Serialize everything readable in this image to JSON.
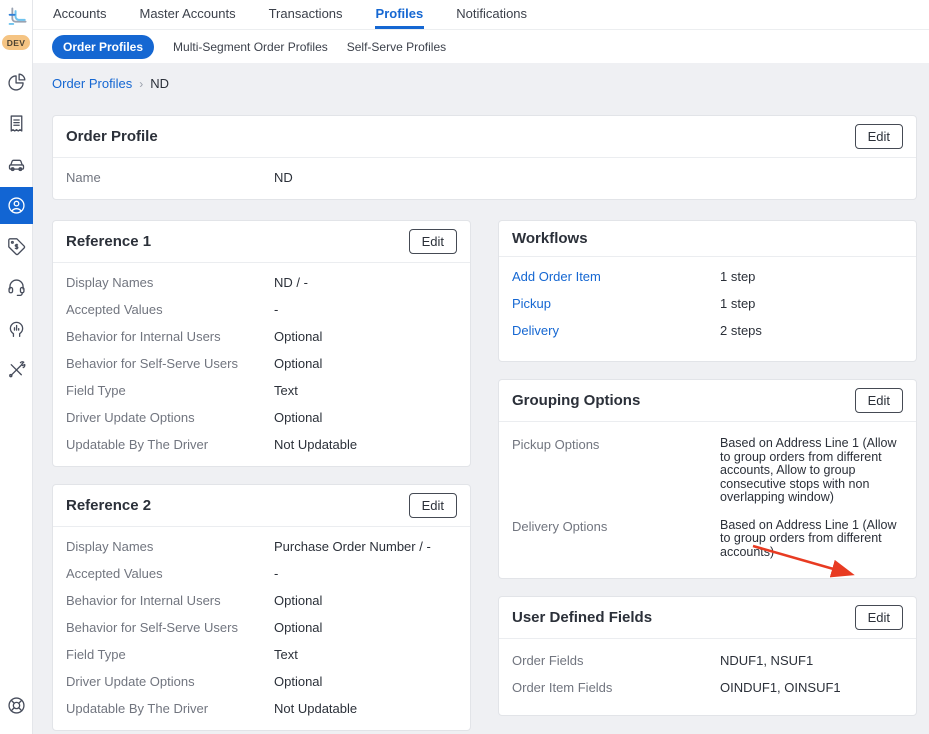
{
  "accent_color": "#1567d2",
  "sidebar": {
    "logo_icon": "route-logo",
    "badge": "DEV",
    "items": [
      {
        "icon": "pie-chart",
        "active": false
      },
      {
        "icon": "receipt",
        "active": false
      },
      {
        "icon": "car",
        "active": false
      },
      {
        "icon": "person-profile",
        "active": true
      },
      {
        "icon": "price-tag",
        "active": false
      },
      {
        "icon": "headset-support",
        "active": false
      },
      {
        "icon": "insights-head",
        "active": false
      },
      {
        "icon": "tools",
        "active": false
      }
    ],
    "bottom_icon": "help-lifebuoy"
  },
  "topnav": {
    "tabs": [
      {
        "label": "Accounts",
        "active": false
      },
      {
        "label": "Master Accounts",
        "active": false
      },
      {
        "label": "Transactions",
        "active": false
      },
      {
        "label": "Profiles",
        "active": true
      },
      {
        "label": "Notifications",
        "active": false
      }
    ]
  },
  "subnav": {
    "tabs": [
      {
        "label": "Order Profiles",
        "active": true
      },
      {
        "label": "Multi-Segment Order Profiles",
        "active": false
      },
      {
        "label": "Self-Serve Profiles",
        "active": false
      }
    ]
  },
  "breadcrumb": {
    "link": "Order Profiles",
    "separator": "›",
    "current": "ND"
  },
  "cards": {
    "order_profile": {
      "title": "Order Profile",
      "edit_label": "Edit",
      "rows": [
        {
          "label": "Name",
          "value": "ND"
        }
      ]
    },
    "reference1": {
      "title": "Reference 1",
      "edit_label": "Edit",
      "rows": [
        {
          "label": "Display Names",
          "value": "ND / -"
        },
        {
          "label": "Accepted Values",
          "value": "-"
        },
        {
          "label": "Behavior for Internal Users",
          "value": "Optional"
        },
        {
          "label": "Behavior for Self-Serve Users",
          "value": "Optional"
        },
        {
          "label": "Field Type",
          "value": "Text"
        },
        {
          "label": "Driver Update Options",
          "value": "Optional"
        },
        {
          "label": "Updatable By The Driver",
          "value": "Not Updatable"
        }
      ]
    },
    "reference2": {
      "title": "Reference 2",
      "edit_label": "Edit",
      "rows": [
        {
          "label": "Display Names",
          "value": "Purchase Order Number / -"
        },
        {
          "label": "Accepted Values",
          "value": "-"
        },
        {
          "label": "Behavior for Internal Users",
          "value": "Optional"
        },
        {
          "label": "Behavior for Self-Serve Users",
          "value": "Optional"
        },
        {
          "label": "Field Type",
          "value": "Text"
        },
        {
          "label": "Driver Update Options",
          "value": "Optional"
        },
        {
          "label": "Updatable By The Driver",
          "value": "Not Updatable"
        }
      ]
    },
    "workflows": {
      "title": "Workflows",
      "rows": [
        {
          "link": "Add Order Item",
          "value": "1 step"
        },
        {
          "link": "Pickup",
          "value": "1 step"
        },
        {
          "link": "Delivery",
          "value": "2 steps"
        }
      ]
    },
    "grouping_options": {
      "title": "Grouping Options",
      "edit_label": "Edit",
      "rows": [
        {
          "label": "Pickup Options",
          "value": "Based on Address Line 1 (Allow to group orders from different accounts, Allow to group consecutive stops with non overlapping window)"
        },
        {
          "label": "Delivery Options",
          "value": "Based on Address Line 1 (Allow to group orders from different accounts)"
        }
      ]
    },
    "user_defined_fields": {
      "title": "User Defined Fields",
      "edit_label": "Edit",
      "rows": [
        {
          "label": "Order Fields",
          "value": "NDUF1, NSUF1"
        },
        {
          "label": "Order Item Fields",
          "value": "OINDUF1, OINSUF1"
        }
      ]
    }
  },
  "annotation": {
    "type": "arrow",
    "color": "#e83b22",
    "points_to": "user-defined-fields-edit-button"
  }
}
